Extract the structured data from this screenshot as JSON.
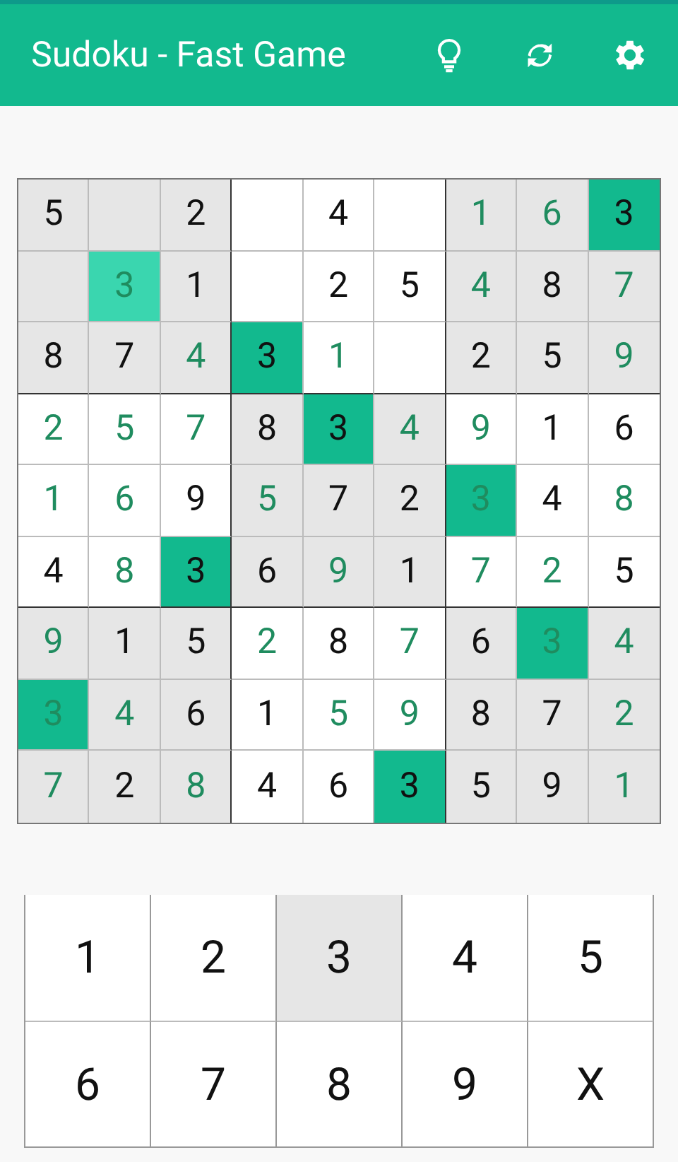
{
  "app_bar": {
    "title": "Sudoku - Fast Game"
  },
  "grid": {
    "rows": [
      [
        {
          "value": "5",
          "given": true,
          "highlighted": false,
          "selected": false
        },
        {
          "highlighted": false,
          "selected": false
        },
        {
          "value": "2",
          "given": true,
          "highlighted": false,
          "selected": false
        },
        {
          "highlighted": false,
          "selected": false
        },
        {
          "value": "4",
          "given": true,
          "highlighted": false,
          "selected": false
        },
        {
          "highlighted": false,
          "selected": false
        },
        {
          "value": "1",
          "given": false,
          "highlighted": false,
          "selected": false
        },
        {
          "value": "6",
          "given": false,
          "highlighted": false,
          "selected": false
        },
        {
          "value": "3",
          "given": true,
          "highlighted": true,
          "selected": false
        }
      ],
      [
        {
          "highlighted": false,
          "selected": false
        },
        {
          "value": "3",
          "given": false,
          "highlighted": false,
          "selected": true
        },
        {
          "value": "1",
          "given": true,
          "highlighted": false,
          "selected": false
        },
        {
          "highlighted": false,
          "selected": false
        },
        {
          "value": "2",
          "given": true,
          "highlighted": false,
          "selected": false
        },
        {
          "value": "5",
          "given": true,
          "highlighted": false,
          "selected": false
        },
        {
          "value": "4",
          "given": false,
          "highlighted": false,
          "selected": false
        },
        {
          "value": "8",
          "given": true,
          "highlighted": false,
          "selected": false
        },
        {
          "value": "7",
          "given": false,
          "highlighted": false,
          "selected": false
        }
      ],
      [
        {
          "value": "8",
          "given": true,
          "highlighted": false,
          "selected": false
        },
        {
          "value": "7",
          "given": true,
          "highlighted": false,
          "selected": false
        },
        {
          "value": "4",
          "given": false,
          "highlighted": false,
          "selected": false
        },
        {
          "value": "3",
          "given": true,
          "highlighted": true,
          "selected": false
        },
        {
          "value": "1",
          "given": false,
          "highlighted": false,
          "selected": false
        },
        {
          "highlighted": false,
          "selected": false
        },
        {
          "value": "2",
          "given": true,
          "highlighted": false,
          "selected": false
        },
        {
          "value": "5",
          "given": true,
          "highlighted": false,
          "selected": false
        },
        {
          "value": "9",
          "given": false,
          "highlighted": false,
          "selected": false
        }
      ],
      [
        {
          "value": "2",
          "given": false,
          "highlighted": false,
          "selected": false
        },
        {
          "value": "5",
          "given": false,
          "highlighted": false,
          "selected": false
        },
        {
          "value": "7",
          "given": false,
          "highlighted": false,
          "selected": false
        },
        {
          "value": "8",
          "given": true,
          "highlighted": false,
          "selected": false
        },
        {
          "value": "3",
          "given": true,
          "highlighted": true,
          "selected": false
        },
        {
          "value": "4",
          "given": false,
          "highlighted": false,
          "selected": false
        },
        {
          "value": "9",
          "given": false,
          "highlighted": false,
          "selected": false
        },
        {
          "value": "1",
          "given": true,
          "highlighted": false,
          "selected": false
        },
        {
          "value": "6",
          "given": true,
          "highlighted": false,
          "selected": false
        }
      ],
      [
        {
          "value": "1",
          "given": false,
          "highlighted": false,
          "selected": false
        },
        {
          "value": "6",
          "given": false,
          "highlighted": false,
          "selected": false
        },
        {
          "value": "9",
          "given": true,
          "highlighted": false,
          "selected": false
        },
        {
          "value": "5",
          "given": false,
          "highlighted": false,
          "selected": false
        },
        {
          "value": "7",
          "given": true,
          "highlighted": false,
          "selected": false
        },
        {
          "value": "2",
          "given": true,
          "highlighted": false,
          "selected": false
        },
        {
          "value": "3",
          "given": false,
          "highlighted": true,
          "selected": false
        },
        {
          "value": "4",
          "given": true,
          "highlighted": false,
          "selected": false
        },
        {
          "value": "8",
          "given": false,
          "highlighted": false,
          "selected": false
        }
      ],
      [
        {
          "value": "4",
          "given": true,
          "highlighted": false,
          "selected": false
        },
        {
          "value": "8",
          "given": false,
          "highlighted": false,
          "selected": false
        },
        {
          "value": "3",
          "given": true,
          "highlighted": true,
          "selected": false
        },
        {
          "value": "6",
          "given": true,
          "highlighted": false,
          "selected": false
        },
        {
          "value": "9",
          "given": false,
          "highlighted": false,
          "selected": false
        },
        {
          "value": "1",
          "given": true,
          "highlighted": false,
          "selected": false
        },
        {
          "value": "7",
          "given": false,
          "highlighted": false,
          "selected": false
        },
        {
          "value": "2",
          "given": false,
          "highlighted": false,
          "selected": false
        },
        {
          "value": "5",
          "given": true,
          "highlighted": false,
          "selected": false
        }
      ],
      [
        {
          "value": "9",
          "given": false,
          "highlighted": false,
          "selected": false
        },
        {
          "value": "1",
          "given": true,
          "highlighted": false,
          "selected": false
        },
        {
          "value": "5",
          "given": true,
          "highlighted": false,
          "selected": false
        },
        {
          "value": "2",
          "given": false,
          "highlighted": false,
          "selected": false
        },
        {
          "value": "8",
          "given": true,
          "highlighted": false,
          "selected": false
        },
        {
          "value": "7",
          "given": false,
          "highlighted": false,
          "selected": false
        },
        {
          "value": "6",
          "given": true,
          "highlighted": false,
          "selected": false
        },
        {
          "value": "3",
          "given": false,
          "highlighted": true,
          "selected": false
        },
        {
          "value": "4",
          "given": false,
          "highlighted": false,
          "selected": false
        }
      ],
      [
        {
          "value": "3",
          "given": false,
          "highlighted": true,
          "selected": false
        },
        {
          "value": "4",
          "given": false,
          "highlighted": false,
          "selected": false
        },
        {
          "value": "6",
          "given": true,
          "highlighted": false,
          "selected": false
        },
        {
          "value": "1",
          "given": true,
          "highlighted": false,
          "selected": false
        },
        {
          "value": "5",
          "given": false,
          "highlighted": false,
          "selected": false
        },
        {
          "value": "9",
          "given": false,
          "highlighted": false,
          "selected": false
        },
        {
          "value": "8",
          "given": true,
          "highlighted": false,
          "selected": false
        },
        {
          "value": "7",
          "given": true,
          "highlighted": false,
          "selected": false
        },
        {
          "value": "2",
          "given": false,
          "highlighted": false,
          "selected": false
        }
      ],
      [
        {
          "value": "7",
          "given": false,
          "highlighted": false,
          "selected": false
        },
        {
          "value": "2",
          "given": true,
          "highlighted": false,
          "selected": false
        },
        {
          "value": "8",
          "given": false,
          "highlighted": false,
          "selected": false
        },
        {
          "value": "4",
          "given": true,
          "highlighted": false,
          "selected": false
        },
        {
          "value": "6",
          "given": true,
          "highlighted": false,
          "selected": false
        },
        {
          "value": "3",
          "given": true,
          "highlighted": true,
          "selected": false
        },
        {
          "value": "5",
          "given": true,
          "highlighted": false,
          "selected": false
        },
        {
          "value": "9",
          "given": true,
          "highlighted": false,
          "selected": false
        },
        {
          "value": "1",
          "given": false,
          "highlighted": false,
          "selected": false
        }
      ]
    ]
  },
  "keypad": [
    {
      "label": "1",
      "selected": false
    },
    {
      "label": "2",
      "selected": false
    },
    {
      "label": "3",
      "selected": true
    },
    {
      "label": "4",
      "selected": false
    },
    {
      "label": "5",
      "selected": false
    },
    {
      "label": "6",
      "selected": false
    },
    {
      "label": "7",
      "selected": false
    },
    {
      "label": "8",
      "selected": false
    },
    {
      "label": "9",
      "selected": false
    },
    {
      "label": "X",
      "selected": false
    }
  ]
}
